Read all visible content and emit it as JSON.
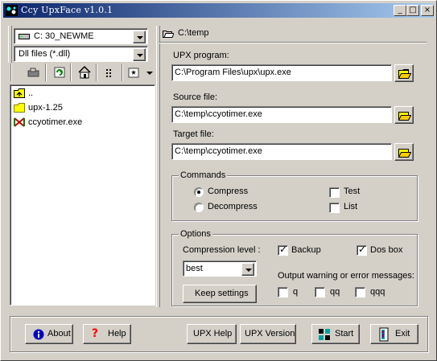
{
  "window": {
    "title": "Ccy UpxFace v1.0.1"
  },
  "titlebar_buttons": {
    "minimize": "_",
    "maximize": "□",
    "close": "×"
  },
  "left_panel": {
    "drive_combo": "C: 30_NEWME",
    "filter_combo": "Dll files (*.dll)",
    "toolbar": [
      "folder-up-icon",
      "refresh-icon",
      "home-icon",
      "view-list-icon",
      "options-icon"
    ],
    "files": [
      {
        "name": "..",
        "icon": "parent-folder-icon"
      },
      {
        "name": "upx-1.25",
        "icon": "folder-icon"
      },
      {
        "name": "ccyotimer.exe",
        "icon": "exe-icon"
      }
    ]
  },
  "current_path": "C:\\temp",
  "upx_program": {
    "label": "UPX program:",
    "value": "C:\\Program Files\\upx\\upx.exe"
  },
  "source_file": {
    "label": "Source file:",
    "value": "C:\\temp\\ccyotimer.exe"
  },
  "target_file": {
    "label": "Target file:",
    "value": "C:\\temp\\ccyotimer.exe"
  },
  "commands": {
    "title": "Commands",
    "compress": "Compress",
    "decompress": "Decompress",
    "test": "Test",
    "list": "List",
    "selected": "Compress"
  },
  "options": {
    "title": "Options",
    "compression_label": "Compression level :",
    "compression_value": "best",
    "backup": "Backup",
    "dos_box": "Dos box",
    "backup_checked": true,
    "dos_box_checked": true,
    "output_label": "Output warning or error messages:",
    "q": "q",
    "qq": "qq",
    "qqq": "qqq",
    "keep_settings": "Keep settings"
  },
  "buttons": {
    "about": "About",
    "help": "Help",
    "upx_help": "UPX Help",
    "upx_version": "UPX Version",
    "start": "Start",
    "exit": "Exit"
  }
}
